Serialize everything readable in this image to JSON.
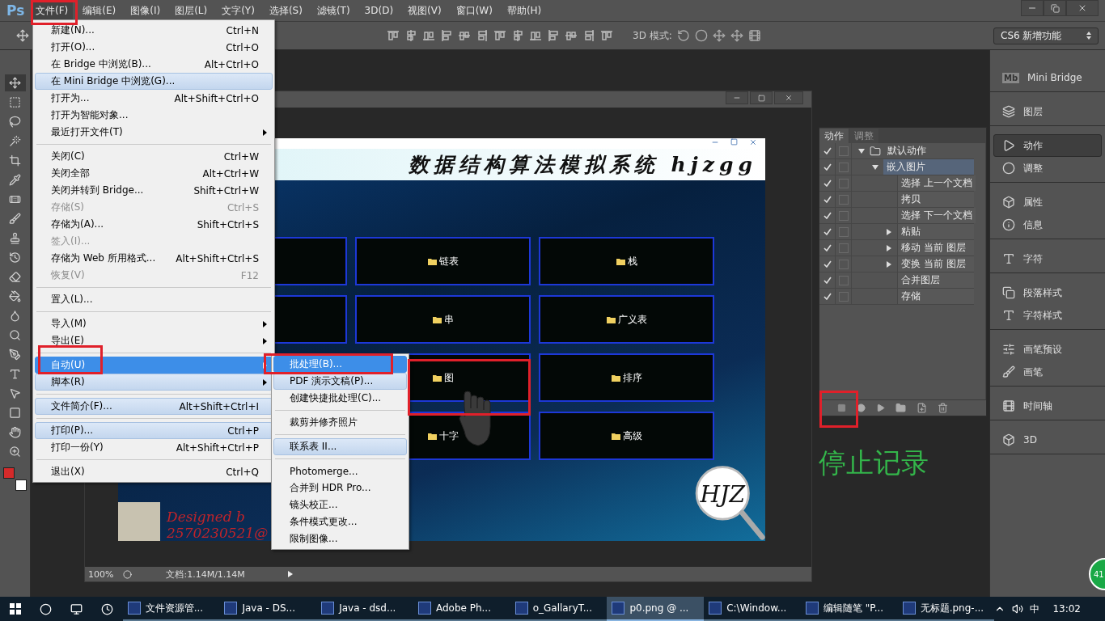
{
  "app": {
    "logo": "Ps"
  },
  "menu_bar": [
    {
      "label": "文件(F)",
      "selected": true
    },
    {
      "label": "编辑(E)",
      "selected": false
    },
    {
      "label": "图像(I)",
      "selected": false
    },
    {
      "label": "图层(L)",
      "selected": false
    },
    {
      "label": "文字(Y)",
      "selected": false
    },
    {
      "label": "选择(S)",
      "selected": false
    },
    {
      "label": "滤镜(T)",
      "selected": false
    },
    {
      "label": "3D(D)",
      "selected": false
    },
    {
      "label": "视图(V)",
      "selected": false
    },
    {
      "label": "窗口(W)",
      "selected": false
    },
    {
      "label": "帮助(H)",
      "selected": false
    }
  ],
  "options_bar": {
    "mode_label": "3D 模式:",
    "workspace": "CS6 新增功能"
  },
  "file_menu": [
    {
      "kind": "item",
      "label": "新建(N)...",
      "shortcut": "Ctrl+N",
      "disabled": false,
      "selected": false,
      "hovered": false,
      "submenu": false
    },
    {
      "kind": "item",
      "label": "打开(O)...",
      "shortcut": "Ctrl+O",
      "disabled": false,
      "selected": false,
      "hovered": false,
      "submenu": false
    },
    {
      "kind": "item",
      "label": "在 Bridge 中浏览(B)...",
      "shortcut": "Alt+Ctrl+O",
      "disabled": false,
      "selected": false,
      "hovered": false,
      "submenu": false
    },
    {
      "kind": "item",
      "label": "在 Mini Bridge 中浏览(G)...",
      "disabled": false,
      "selected": false,
      "hovered": true,
      "submenu": false
    },
    {
      "kind": "item",
      "label": "打开为...",
      "shortcut": "Alt+Shift+Ctrl+O",
      "disabled": false,
      "selected": false,
      "hovered": false,
      "submenu": false
    },
    {
      "kind": "item",
      "label": "打开为智能对象...",
      "disabled": false,
      "selected": false,
      "hovered": false,
      "submenu": false
    },
    {
      "kind": "item",
      "label": "最近打开文件(T)",
      "disabled": false,
      "selected": false,
      "hovered": false,
      "submenu": true
    },
    {
      "kind": "separator"
    },
    {
      "kind": "item",
      "label": "关闭(C)",
      "shortcut": "Ctrl+W",
      "disabled": false,
      "selected": false,
      "hovered": false,
      "submenu": false
    },
    {
      "kind": "item",
      "label": "关闭全部",
      "shortcut": "Alt+Ctrl+W",
      "disabled": false,
      "selected": false,
      "hovered": false,
      "submenu": false
    },
    {
      "kind": "item",
      "label": "关闭并转到 Bridge...",
      "shortcut": "Shift+Ctrl+W",
      "disabled": false,
      "selected": false,
      "hovered": false,
      "submenu": false
    },
    {
      "kind": "item",
      "label": "存储(S)",
      "shortcut": "Ctrl+S",
      "disabled": true,
      "selected": false,
      "hovered": false,
      "submenu": false
    },
    {
      "kind": "item",
      "label": "存储为(A)...",
      "shortcut": "Shift+Ctrl+S",
      "disabled": false,
      "selected": false,
      "hovered": false,
      "submenu": false
    },
    {
      "kind": "item",
      "label": "签入(I)...",
      "disabled": true,
      "selected": false,
      "hovered": false,
      "submenu": false
    },
    {
      "kind": "item",
      "label": "存储为 Web 所用格式...",
      "shortcut": "Alt+Shift+Ctrl+S",
      "disabled": false,
      "selected": false,
      "hovered": false,
      "submenu": false
    },
    {
      "kind": "item",
      "label": "恢复(V)",
      "shortcut": "F12",
      "disabled": true,
      "selected": false,
      "hovered": false,
      "submenu": false
    },
    {
      "kind": "separator"
    },
    {
      "kind": "item",
      "label": "置入(L)...",
      "disabled": false,
      "selected": false,
      "hovered": false,
      "submenu": false
    },
    {
      "kind": "separator"
    },
    {
      "kind": "item",
      "label": "导入(M)",
      "disabled": false,
      "selected": false,
      "hovered": false,
      "submenu": true
    },
    {
      "kind": "item",
      "label": "导出(E)",
      "disabled": false,
      "selected": false,
      "hovered": false,
      "submenu": true
    },
    {
      "kind": "separator"
    },
    {
      "kind": "item",
      "label": "自动(U)",
      "disabled": false,
      "selected": true,
      "hovered": false,
      "submenu": true
    },
    {
      "kind": "item",
      "label": "脚本(R)",
      "disabled": false,
      "selected": false,
      "hovered": true,
      "submenu": true
    },
    {
      "kind": "separator"
    },
    {
      "kind": "item",
      "label": "文件简介(F)...",
      "shortcut": "Alt+Shift+Ctrl+I",
      "disabled": false,
      "selected": false,
      "hovered": true,
      "submenu": false
    },
    {
      "kind": "separator"
    },
    {
      "kind": "item",
      "label": "打印(P)...",
      "shortcut": "Ctrl+P",
      "disabled": false,
      "selected": false,
      "hovered": true,
      "submenu": false
    },
    {
      "kind": "item",
      "label": "打印一份(Y)",
      "shortcut": "Alt+Shift+Ctrl+P",
      "disabled": false,
      "selected": false,
      "hovered": false,
      "submenu": false
    },
    {
      "kind": "separator"
    },
    {
      "kind": "item",
      "label": "退出(X)",
      "shortcut": "Ctrl+Q",
      "disabled": false,
      "selected": false,
      "hovered": false,
      "submenu": false
    }
  ],
  "automate_submenu": [
    {
      "kind": "item",
      "label": "批处理(B)...",
      "selected": true,
      "hovered": false
    },
    {
      "kind": "item",
      "label": "PDF 演示文稿(P)...",
      "selected": false,
      "hovered": true
    },
    {
      "kind": "item",
      "label": "创建快捷批处理(C)...",
      "selected": false,
      "hovered": false
    },
    {
      "kind": "separator"
    },
    {
      "kind": "item",
      "label": "裁剪并修齐照片",
      "selected": false,
      "hovered": false
    },
    {
      "kind": "separator"
    },
    {
      "kind": "item",
      "label": "联系表 II...",
      "selected": false,
      "hovered": true
    },
    {
      "kind": "separator"
    },
    {
      "kind": "item",
      "label": "Photomerge...",
      "selected": false,
      "hovered": false
    },
    {
      "kind": "item",
      "label": "合并到 HDR Pro...",
      "selected": false,
      "hovered": false
    },
    {
      "kind": "item",
      "label": "镜头校正...",
      "selected": false,
      "hovered": false
    },
    {
      "kind": "item",
      "label": "条件模式更改...",
      "selected": false,
      "hovered": false
    },
    {
      "kind": "item",
      "label": "限制图像...",
      "selected": false,
      "hovered": false
    }
  ],
  "document": {
    "zoom": "100%",
    "doc_info": "文档:1.14M/1.14M",
    "content": {
      "title": "数据结构算法模拟系统 hjzgg",
      "tiles": [
        {
          "label": "链表"
        },
        {
          "label": "栈"
        },
        {
          "label": "串"
        },
        {
          "label": "广义表"
        },
        {
          "label": "图"
        },
        {
          "label": "排序"
        },
        {
          "label": "十字"
        },
        {
          "label": "高级"
        }
      ],
      "credit_lines": [
        "Designed b",
        "2570230521@"
      ],
      "logo": "HJZ"
    }
  },
  "actions_panel": {
    "tabs": [
      {
        "label": "动作",
        "selected": true
      },
      {
        "label": "调整",
        "selected": false
      }
    ],
    "rows": [
      {
        "label": "默认动作",
        "kind": "set",
        "enabled": true,
        "expanded": true,
        "selected": false,
        "children": [
          {
            "label": "嵌入图片",
            "kind": "action",
            "enabled": true,
            "expanded": true,
            "selected": true,
            "children": [
              {
                "label": "选择 上一个文档",
                "kind": "step",
                "enabled": true,
                "selected": false
              },
              {
                "label": "拷贝",
                "kind": "step",
                "enabled": true,
                "selected": false
              },
              {
                "label": "选择 下一个文档",
                "kind": "step",
                "enabled": true,
                "selected": false
              },
              {
                "label": "粘贴",
                "kind": "step",
                "enabled": true,
                "expanded": false,
                "selected": false
              },
              {
                "label": "移动 当前 图层",
                "kind": "step",
                "enabled": true,
                "expanded": false,
                "selected": false
              },
              {
                "label": "变换 当前 图层",
                "kind": "step",
                "enabled": true,
                "expanded": false,
                "selected": false
              },
              {
                "label": "合并图层",
                "kind": "step",
                "enabled": true,
                "selected": false
              },
              {
                "label": "存储",
                "kind": "step",
                "enabled": true,
                "selected": false
              }
            ]
          }
        ]
      }
    ]
  },
  "panel_dock": [
    {
      "items": [
        {
          "label": "Mini Bridge",
          "icon_text": "Mb",
          "selected": false
        }
      ]
    },
    {
      "items": [
        {
          "label": "图层",
          "selected": false
        }
      ]
    },
    {
      "items": [
        {
          "label": "动作",
          "selected": true
        },
        {
          "label": "调整",
          "selected": false
        }
      ]
    },
    {
      "items": [
        {
          "label": "属性",
          "selected": false
        },
        {
          "label": "信息",
          "selected": false
        }
      ]
    },
    {
      "items": [
        {
          "label": "字符",
          "selected": false
        }
      ]
    },
    {
      "items": [
        {
          "label": "段落样式",
          "selected": false
        },
        {
          "label": "字符样式",
          "selected": false
        }
      ]
    },
    {
      "items": [
        {
          "label": "画笔预设",
          "selected": false
        },
        {
          "label": "画笔",
          "selected": false
        }
      ]
    },
    {
      "items": [
        {
          "label": "时间轴",
          "selected": false
        }
      ]
    },
    {
      "items": [
        {
          "label": "3D",
          "selected": false
        }
      ]
    }
  ],
  "tools": {
    "swatches": [
      {
        "color": "#d42a2a"
      },
      {
        "color": "#ffffff"
      }
    ]
  },
  "annotation": {
    "text": "停止记录"
  },
  "corner_badge": "41",
  "taskbar": {
    "apps": [
      {
        "label": "文件资源管...",
        "selected": false
      },
      {
        "label": "Java - DS...",
        "selected": false
      },
      {
        "label": "Java - dsd...",
        "selected": false
      },
      {
        "label": "Adobe Ph...",
        "selected": false
      },
      {
        "label": "o_GallaryT...",
        "selected": false
      },
      {
        "label": "p0.png @ ...",
        "selected": true
      },
      {
        "label": "C:\\Window...",
        "selected": false
      },
      {
        "label": "编辑随笔 \"P...",
        "selected": false
      },
      {
        "label": "无标题.png-...",
        "selected": false
      }
    ],
    "ime": "中",
    "time": "13:02"
  }
}
